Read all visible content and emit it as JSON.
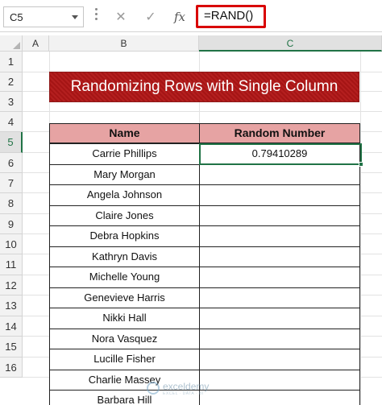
{
  "formula_bar": {
    "name_box": "C5",
    "cancel_icon": "✕",
    "enter_icon": "✓",
    "fx_label": "fx",
    "formula": "=RAND()"
  },
  "columns": [
    "A",
    "B",
    "C"
  ],
  "rows": [
    "1",
    "2",
    "3",
    "4",
    "5",
    "6",
    "7",
    "8",
    "9",
    "10",
    "11",
    "12",
    "13",
    "14",
    "15",
    "16"
  ],
  "selected": {
    "column": "C",
    "row": "5"
  },
  "title": "Randomizing Rows with Single Column",
  "table": {
    "headers": [
      "Name",
      "Random Number"
    ],
    "names": [
      "Carrie Phillips",
      "Mary Morgan",
      "Angela Johnson",
      "Claire Jones",
      "Debra Hopkins",
      "Kathryn Davis",
      "Michelle Young",
      "Genevieve Harris",
      "Nikki Hall",
      "Nora Vasquez",
      "Lucille Fisher",
      "Charlie Massey",
      "Barbara Hill"
    ],
    "random_numbers": [
      "0.79410289",
      "",
      "",
      "",
      "",
      "",
      "",
      "",
      "",
      "",
      "",
      "",
      ""
    ]
  },
  "watermark": {
    "brand": "exceldemy",
    "tagline": "EXCEL · DATA · BI"
  },
  "colors": {
    "accent_green": "#217346",
    "title_red": "#b41f1f",
    "header_pink": "#e6a3a3",
    "highlight_red": "#d90000"
  }
}
